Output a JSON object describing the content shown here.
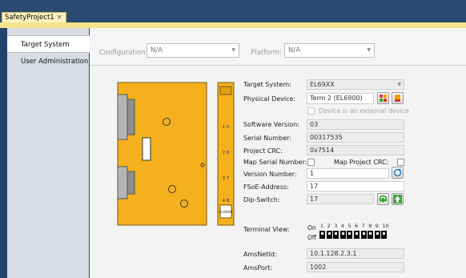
{
  "doc_tab": {
    "title": "SafetyProject1",
    "close": "×"
  },
  "nav": {
    "items": [
      {
        "label": "Target System"
      },
      {
        "label": "User Administration"
      }
    ]
  },
  "config": {
    "configuration_label": "Configuration:",
    "configuration_value": "N/A",
    "platform_label": "Platform:",
    "platform_value": "N/A"
  },
  "device": {
    "silk": [
      "1 5",
      "2 6",
      "3 7",
      "4 8"
    ],
    "model": "EL6900",
    "target_system_label": "Target System:",
    "target_system_value": "EL69XX",
    "physical_device_label": "Physical Device:",
    "physical_device_value": "Term 2 (EL6900)",
    "external_device_label": "Device is an external device",
    "software_version_label": "Software Version:",
    "software_version_value": "03",
    "serial_number_label": "Serial Number:",
    "serial_number_value": "00317535",
    "project_crc_label": "Project CRC:",
    "project_crc_value": "0x7514",
    "map_serial_label": "Map Serial Number:",
    "map_project_crc_label": "Map Project CRC:",
    "version_number_label": "Version Number:",
    "version_number_value": "1",
    "fsoe_label": "FSoE-Address:",
    "fsoe_value": "17",
    "dip_label": "Dip-Switch:",
    "dip_value": "17",
    "terminal_view_label": "Terminal View:",
    "on_label": "On",
    "off_label": "Off",
    "dip_numbers": [
      "1",
      "2",
      "3",
      "4",
      "5",
      "6",
      "7",
      "8",
      "9",
      "10"
    ],
    "amsnetid_label": "AmsNetId:",
    "amsnetid_value": "10.1.128.2.3.1",
    "amsport_label": "AmsPort:",
    "amsport_value": "1002"
  },
  "colors": {
    "terminal": "#f5b01e",
    "accent": "#2b4a72",
    "tab": "#fdf3c2"
  }
}
